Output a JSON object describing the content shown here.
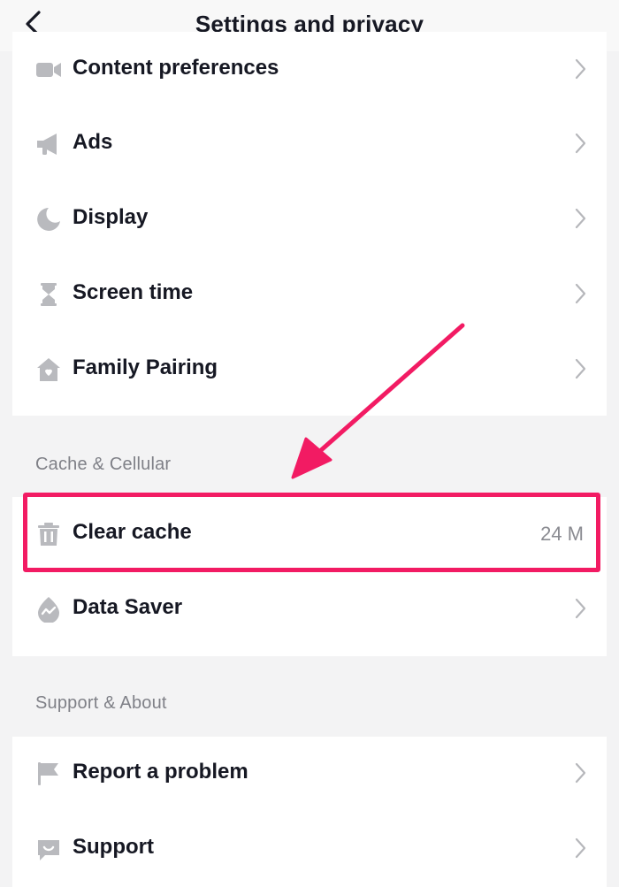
{
  "header": {
    "title": "Settings and privacy",
    "back_icon": "chevron-left-icon"
  },
  "group_top": {
    "items": [
      {
        "label": "Content preferences",
        "icon": "video-camera-icon"
      },
      {
        "label": "Ads",
        "icon": "megaphone-icon"
      },
      {
        "label": "Display",
        "icon": "moon-icon"
      },
      {
        "label": "Screen time",
        "icon": "hourglass-icon"
      },
      {
        "label": "Family Pairing",
        "icon": "house-icon"
      }
    ]
  },
  "cache_section": {
    "title": "Cache & Cellular",
    "items": [
      {
        "label": "Clear cache",
        "icon": "trash-icon",
        "value": "24 M"
      },
      {
        "label": "Data Saver",
        "icon": "data-saver-icon"
      }
    ]
  },
  "support_section": {
    "title": "Support & About",
    "items": [
      {
        "label": "Report a problem",
        "icon": "flag-icon"
      },
      {
        "label": "Support",
        "icon": "chat-bubble-icon"
      }
    ]
  },
  "colors": {
    "highlight": "#f21b63",
    "icon_gray": "#b9babe",
    "chevron_gray": "#b6b7bb",
    "text": "#161823"
  }
}
